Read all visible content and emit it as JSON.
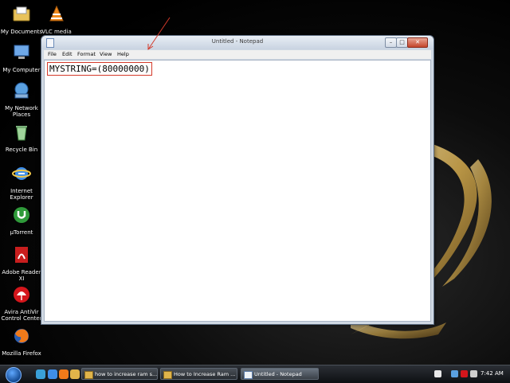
{
  "desktop_icons": [
    {
      "id": "my-documents",
      "label": "My Documents"
    },
    {
      "id": "vlc",
      "label": "VLC media player"
    },
    {
      "id": "my-computer",
      "label": "My Computer"
    },
    {
      "id": "my-network-places",
      "label": "My Network Places"
    },
    {
      "id": "recycle-bin",
      "label": "Recycle Bin"
    },
    {
      "id": "internet-explorer",
      "label": "Internet Explorer"
    },
    {
      "id": "utorrent",
      "label": "µTorrent"
    },
    {
      "id": "adobe-reader",
      "label": "Adobe Reader XI"
    },
    {
      "id": "avira",
      "label": "Avira AntiVir Control Center"
    },
    {
      "id": "firefox",
      "label": "Mozilla Firefox"
    }
  ],
  "notepad": {
    "title": "Untitled - Notepad",
    "menu": [
      "File",
      "Edit",
      "Format",
      "View",
      "Help"
    ],
    "content": "MYSTRING=(80000000)",
    "controls": {
      "minimize": "–",
      "maximize": "□",
      "close": "✕"
    }
  },
  "taskbar": {
    "tasks": [
      {
        "label": "how to increase ram s...",
        "icon": "folder-icon",
        "active": false
      },
      {
        "label": "How to Increase Ram ...",
        "icon": "folder-icon",
        "active": false
      },
      {
        "label": "Untitled - Notepad",
        "icon": "notepad-icon",
        "active": true
      }
    ],
    "clock": "7:42 AM",
    "quicklaunch_icons": [
      "show-desktop-icon",
      "internet-explorer-icon",
      "firefox-icon",
      "folder-icon"
    ]
  },
  "colors": {
    "annotation_red": "#d43a2a",
    "accent_gold": "#c9a24a"
  }
}
